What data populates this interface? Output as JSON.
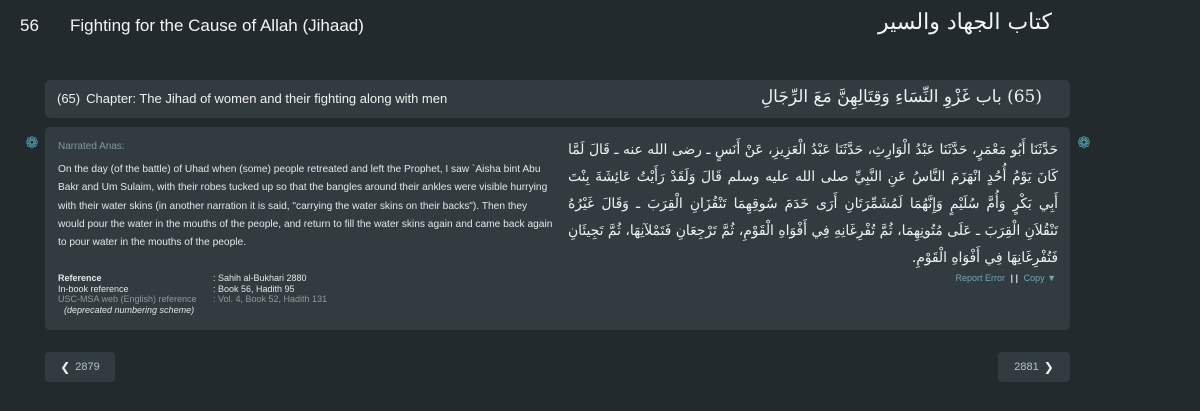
{
  "book": {
    "number": "56",
    "title_en": "Fighting for the Cause of Allah (Jihaad)",
    "title_ar": "كتاب الجهاد والسير"
  },
  "chapter": {
    "number_en": "(65)",
    "title_en": "Chapter: The Jihad of women and their fighting along with men",
    "title_ar": "(65) باب غَزْوِ النِّسَاءِ وَقِتَالِهِنَّ مَعَ الرِّجَالِ"
  },
  "hadith": {
    "narrator": "Narrated Anas:",
    "english": "On the day (of the battle) of Uhad when (some) people retreated and left the Prophet, I saw `Aisha bint Abu Bakr and Um Sulaim, with their robes tucked up so that the bangles around their ankles were visible hurrying with their water skins (in another narration it is said, \"carrying the water skins on their backs\"). Then they would pour the water in the mouths of the people, and return to fill the water skins again and came back again to pour water in the mouths of the people.",
    "arabic": "حَدَّثَنَا أَبُو مَعْمَرٍ، حَدَّثَنَا عَبْدُ الْوَارِثِ، حَدَّثَنَا عَبْدُ الْعَزِيزِ، عَنْ أَنَسٍ ـ رضى الله عنه ـ قَالَ لَمَّا كَانَ يَوْمُ أُحُدٍ انْهَزَمَ النَّاسُ عَنِ النَّبِيِّ صلى الله عليه وسلم قَالَ وَلَقَدْ رَأَيْتُ عَائِشَةَ بِنْتَ أَبِي بَكْرٍ وَأُمَّ سُلَيْمٍ وَإِنَّهُمَا لَمُشَمِّرَتَانِ أَرَى خَدَمَ سُوقِهِمَا تَنْقُزَانِ الْقِرَبَ ـ وَقَالَ غَيْرُهُ تَنْقُلاَنِ الْقِرَبَ ـ عَلَى مُتُونِهِمَا، ثُمَّ تُفْرِغَانِهِ فِي أَفْوَاهِ الْقَوْمِ، ثُمَّ تَرْجِعَانِ فَتَمْلآنِهَا، ثُمَّ تَجِيئَانِ فَتُفْرِغَانِهَا فِي أَفْوَاهِ الْقَوْمِ‏."
  },
  "reference": {
    "rows": [
      {
        "label": "Reference",
        "value": ": Sahih al-Bukhari 2880"
      },
      {
        "label": "In-book reference",
        "value": ": Book 56, Hadith 95"
      },
      {
        "label": "USC-MSA web (English) reference",
        "value": ": Vol. 4, Book 52, Hadith 131"
      }
    ],
    "note": "(deprecated numbering scheme)"
  },
  "actions": {
    "report": "Report Error",
    "separator": "| |",
    "copy": "Copy ▼"
  },
  "nav": {
    "prev_label": "2879",
    "next_label": "2881"
  },
  "icons": {
    "hadith_marker": "flower-icon",
    "prev": "chevron-left-icon",
    "next": "chevron-right-icon"
  },
  "colors": {
    "background": "#222a2d",
    "panel": "#323b3f",
    "accent": "#56a7b4"
  }
}
